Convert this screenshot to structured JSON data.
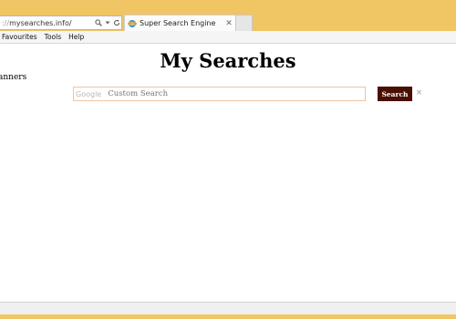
{
  "browser": {
    "address_prefix": "://",
    "address_url": "mysearches.info/",
    "tab_title": "Super Search Engine",
    "accent_color": "#f0c563"
  },
  "menu": {
    "items": [
      "Favourites",
      "Tools",
      "Help"
    ]
  },
  "page": {
    "title": "My Searches",
    "side_label": "anners"
  },
  "search": {
    "logo_text": "Google",
    "placeholder": "Custom Search",
    "button_label": "Search",
    "button_color": "#4a0f02",
    "clear_symbol": "×"
  },
  "icons": [
    "search-icon",
    "dropdown-arrow-icon",
    "refresh-icon",
    "ie-favicon",
    "tab-close-icon",
    "clear-icon"
  ]
}
